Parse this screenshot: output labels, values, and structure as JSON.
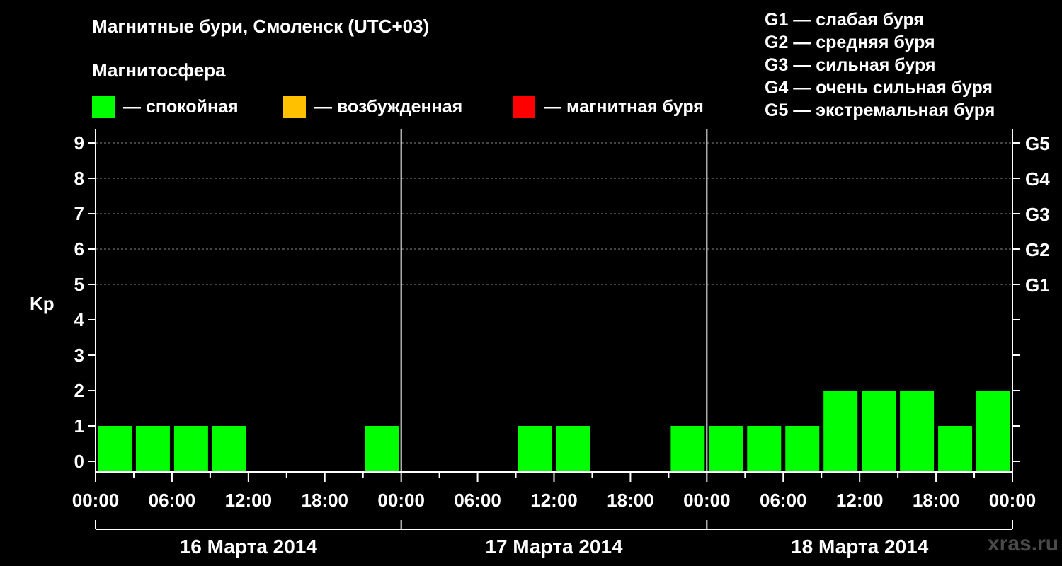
{
  "title": "Магнитные бури, Смоленск (UTC+03)",
  "subtitle": "Магнитосфера",
  "legend": [
    {
      "color": "#00ff00",
      "label": "— спокойная"
    },
    {
      "color": "#ffc000",
      "label": "— возбужденная"
    },
    {
      "color": "#ff0000",
      "label": "— магнитная буря"
    }
  ],
  "g_scale": [
    "G1 — слабая буря",
    "G2 — средняя буря",
    "G3 — сильная буря",
    "G4 — очень сильная буря",
    "G5 — экстремальная буря"
  ],
  "watermark": "xras.ru",
  "chart_data": {
    "type": "bar",
    "ylabel": "Kp",
    "ylim": [
      0,
      9
    ],
    "yticks": [
      0,
      1,
      2,
      3,
      4,
      5,
      6,
      7,
      8,
      9
    ],
    "right_ticks": [
      {
        "value": 5,
        "label": "G1"
      },
      {
        "value": 6,
        "label": "G2"
      },
      {
        "value": 7,
        "label": "G3"
      },
      {
        "value": 8,
        "label": "G4"
      },
      {
        "value": 9,
        "label": "G5"
      }
    ],
    "grid": "dashed horizontal at 5-9",
    "xticks": [
      "00:00",
      "06:00",
      "12:00",
      "18:00",
      "00:00",
      "06:00",
      "12:00",
      "18:00",
      "00:00",
      "06:00",
      "12:00",
      "18:00",
      "00:00"
    ],
    "days": [
      "16 Марта 2014",
      "17 Марта 2014",
      "18 Марта 2014"
    ],
    "bar_interval_hours": 3,
    "values": [
      1,
      1,
      1,
      1,
      0,
      0,
      0,
      1,
      0,
      0,
      0,
      1,
      1,
      0,
      0,
      1,
      1,
      1,
      1,
      2,
      2,
      2,
      1,
      2
    ],
    "colors": {
      "quiet": "#00ff00",
      "active": "#ffc000",
      "storm": "#ff0000"
    }
  }
}
